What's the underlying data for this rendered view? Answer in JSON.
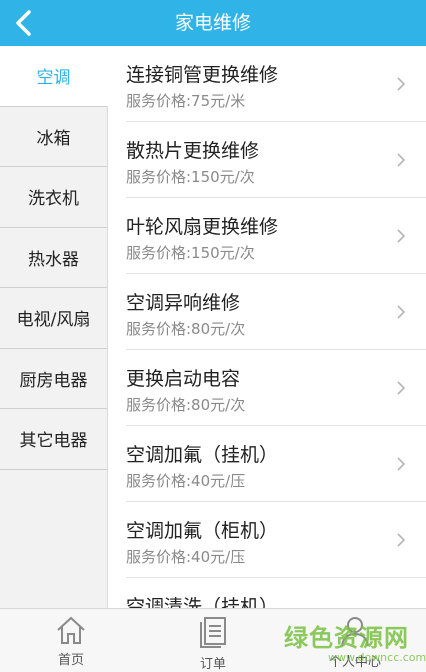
{
  "header": {
    "title": "家电维修",
    "back_icon": "back-arrow-icon"
  },
  "sidebar": {
    "items": [
      {
        "label": "空调"
      },
      {
        "label": "冰箱"
      },
      {
        "label": "洗衣机"
      },
      {
        "label": "热水器"
      },
      {
        "label": "电视/风扇"
      },
      {
        "label": "厨房电器"
      },
      {
        "label": "其它电器"
      }
    ],
    "active_index": 0
  },
  "services": [
    {
      "name": "连接铜管更换维修",
      "price": "服务价格:75元/米"
    },
    {
      "name": "散热片更换维修",
      "price": "服务价格:150元/次"
    },
    {
      "name": "叶轮风扇更换维修",
      "price": "服务价格:150元/次"
    },
    {
      "name": "空调异响维修",
      "price": "服务价格:80元/次"
    },
    {
      "name": "更换启动电容",
      "price": "服务价格:80元/次"
    },
    {
      "name": "空调加氟（挂机）",
      "price": "服务价格:40元/压"
    },
    {
      "name": "空调加氟（柜机）",
      "price": "服务价格:40元/压"
    },
    {
      "name": "空调清洗（挂机）",
      "price": ""
    }
  ],
  "tabbar": {
    "tabs": [
      {
        "label": "首页",
        "icon": "home-icon"
      },
      {
        "label": "订单",
        "icon": "order-icon"
      },
      {
        "label": "个人中心",
        "icon": "user-icon"
      }
    ]
  },
  "watermark": {
    "main": "绿色资源网",
    "sub": "www.downcc.com"
  },
  "colors": {
    "accent": "#30b4e8",
    "watermark": "#79c142"
  }
}
